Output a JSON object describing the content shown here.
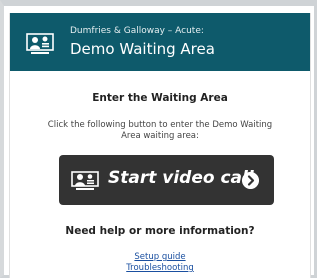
{
  "header": {
    "subtitle": "Dumfries & Galloway – Acute:",
    "title": "Demo Waiting Area",
    "logo_icon": "video-consult-people-icon",
    "background_color": "#0e5a6b"
  },
  "enter": {
    "heading": "Enter the Waiting Area",
    "instructions": "Click the following button to enter the Demo Waiting Area waiting area:"
  },
  "call_button": {
    "label": "Start video call",
    "icon": "video-consult-people-icon",
    "arrow_icon": "chevron-right-circle-icon",
    "background_color": "#333333"
  },
  "help": {
    "heading": "Need help or more information?",
    "links": [
      {
        "label": "Setup guide"
      },
      {
        "label": "Troubleshooting"
      }
    ],
    "link_color": "#1a4fa0"
  }
}
